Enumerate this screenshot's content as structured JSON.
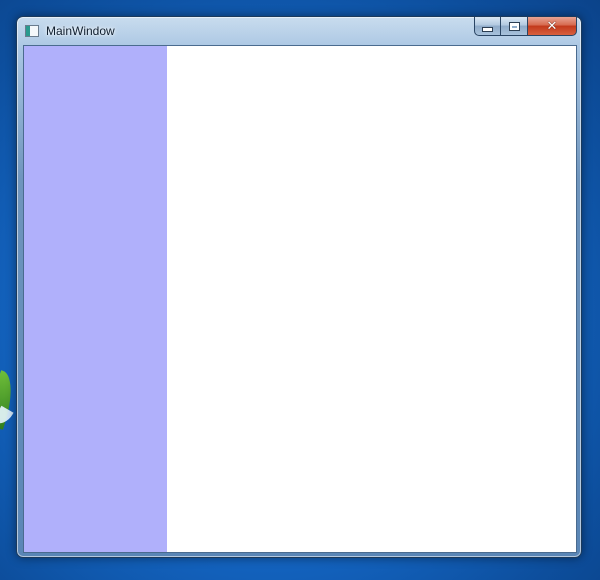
{
  "window": {
    "title": "MainWindow",
    "caption_buttons": {
      "minimize_icon": "minimize-icon",
      "maximize_icon": "maximize-icon",
      "close_glyph": "✕",
      "close_icon": "close-icon"
    }
  },
  "client": {
    "left_panel_color": "#b0b0fb",
    "right_panel_color": "#ffffff"
  },
  "colors": {
    "close_button": "#c2391b",
    "frame": "#6f95bd"
  }
}
